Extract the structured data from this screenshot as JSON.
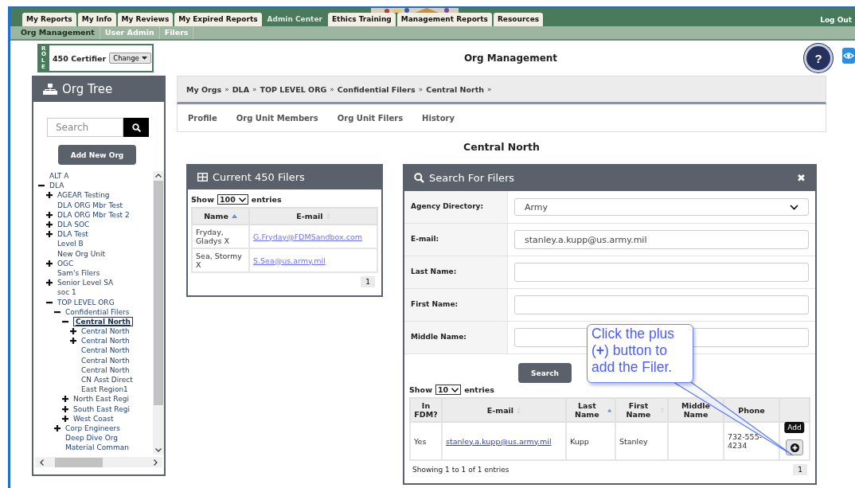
{
  "top_tabs": [
    {
      "label": "My Reports",
      "selected": false
    },
    {
      "label": "My Info",
      "selected": false
    },
    {
      "label": "My Reviews",
      "selected": false
    },
    {
      "label": "My Expired Reports",
      "selected": false
    },
    {
      "label": "Admin Center",
      "selected": true
    },
    {
      "label": "Ethics Training",
      "selected": false
    },
    {
      "label": "Management Reports",
      "selected": false
    },
    {
      "label": "Resources",
      "selected": false
    }
  ],
  "logout": "Log Out",
  "sub_nav": [
    {
      "label": "Org Management",
      "selected": true
    },
    {
      "label": "User Admin",
      "selected": false
    },
    {
      "label": "Filers",
      "selected": false
    }
  ],
  "role": {
    "tag": "ROLE",
    "name": "450 Certifier",
    "button": "Change"
  },
  "page_title": "Org Management",
  "help_button": "?",
  "org_tree": {
    "title": "Org Tree",
    "search_placeholder": "Search",
    "add_button": "Add New Org",
    "items": [
      {
        "label": "ALT A",
        "kind": "leaf",
        "selected": false
      },
      {
        "label": "DLA",
        "kind": "node",
        "expanded": true,
        "selected": false,
        "children": [
          {
            "label": "AGEAR Testing",
            "kind": "node",
            "expanded": false,
            "selected": false
          },
          {
            "label": "DLA ORG Mbr Test",
            "kind": "leaf",
            "selected": false
          },
          {
            "label": "DLA ORG Mbr Test 2",
            "kind": "node",
            "expanded": false,
            "selected": false
          },
          {
            "label": "DLA SOC",
            "kind": "node",
            "expanded": false,
            "selected": false
          },
          {
            "label": "DLA Test",
            "kind": "node",
            "expanded": false,
            "selected": false
          },
          {
            "label": "Level B",
            "kind": "leaf",
            "selected": false
          },
          {
            "label": "New Org Unit",
            "kind": "leaf",
            "selected": false
          },
          {
            "label": "OGC",
            "kind": "node",
            "expanded": false,
            "selected": false
          },
          {
            "label": "Sam's Filers",
            "kind": "leaf",
            "selected": false
          },
          {
            "label": "Senior Level SA",
            "kind": "node",
            "expanded": false,
            "selected": false
          },
          {
            "label": "soc 1",
            "kind": "leaf",
            "selected": false
          },
          {
            "label": "TOP LEVEL ORG",
            "kind": "node",
            "expanded": true,
            "selected": false,
            "children": [
              {
                "label": "Confidential Filers",
                "kind": "node",
                "expanded": true,
                "selected": false,
                "children": [
                  {
                    "label": "Central North",
                    "kind": "node",
                    "expanded": true,
                    "selected": true,
                    "children": [
                      {
                        "label": "Central North",
                        "kind": "node",
                        "expanded": false,
                        "selected": false
                      },
                      {
                        "label": "Central North",
                        "kind": "node",
                        "expanded": false,
                        "selected": false
                      },
                      {
                        "label": "Central North",
                        "kind": "leaf",
                        "selected": false
                      },
                      {
                        "label": "Central North",
                        "kind": "leaf",
                        "selected": false
                      },
                      {
                        "label": "Central North",
                        "kind": "leaf",
                        "selected": false
                      },
                      {
                        "label": "CN Asst Direct",
                        "kind": "leaf",
                        "selected": false
                      },
                      {
                        "label": "East Region1",
                        "kind": "leaf",
                        "selected": false
                      }
                    ]
                  },
                  {
                    "label": "North East Regi",
                    "kind": "node",
                    "expanded": false,
                    "selected": false
                  },
                  {
                    "label": "South East Regi",
                    "kind": "node",
                    "expanded": false,
                    "selected": false
                  },
                  {
                    "label": "West Coast",
                    "kind": "node",
                    "expanded": false,
                    "selected": false
                  }
                ]
              },
              {
                "label": "Corp Engineers",
                "kind": "node",
                "expanded": false,
                "selected": false
              },
              {
                "label": "Deep Dive Org",
                "kind": "leaf",
                "selected": false
              },
              {
                "label": "Material Comman",
                "kind": "leaf",
                "selected": false
              }
            ]
          }
        ]
      }
    ]
  },
  "breadcrumb": [
    "My Orgs",
    "DLA",
    "TOP LEVEL ORG",
    "Confidential Filers",
    "Central North"
  ],
  "breadcrumb_separator": "»",
  "org_tabs": [
    {
      "label": "Profile",
      "selected": false
    },
    {
      "label": "Org Unit Members",
      "selected": false
    },
    {
      "label": "Org Unit Filers",
      "selected": false
    },
    {
      "label": "History",
      "selected": false
    }
  ],
  "org_title": "Central North",
  "current_filers": {
    "title": "Current 450 Filers",
    "show": "Show",
    "page_size": "100",
    "entries": "entries",
    "columns": [
      {
        "label": "Name",
        "sortable": true,
        "sorted": true
      },
      {
        "label": "E-mail",
        "sortable": true,
        "sorted": false
      }
    ],
    "rows": [
      [
        {
          "text": "Fryday, Gladys X",
          "kind": "text"
        },
        {
          "text": "G.Fryday@FDMSandbox.com",
          "kind": "link"
        }
      ],
      [
        {
          "text": "Sea, Stormy X",
          "kind": "text"
        },
        {
          "text": "S.Sea@us.army.mil",
          "kind": "link"
        }
      ]
    ],
    "page": "1"
  },
  "search_filers": {
    "title": "Search For Filers",
    "close": "✖",
    "fields": [
      {
        "label": "Agency Directory:",
        "kind": "select",
        "value": "Army"
      },
      {
        "label": "E-mail:",
        "kind": "text",
        "value": "stanley.a.kupp@us.army.mil"
      },
      {
        "label": "Last Name:",
        "kind": "text"
      },
      {
        "label": "First Name:",
        "kind": "text"
      },
      {
        "label": "Middle Name:",
        "kind": "text"
      }
    ],
    "search_button": "Search",
    "show": "Show",
    "page_size": "10",
    "entries": "entries",
    "columns": [
      {
        "label": "In FDM?",
        "sortable": false,
        "sorted": false
      },
      {
        "label": "E-mail",
        "sortable": true,
        "sorted": false
      },
      {
        "label": "Last Name",
        "sortable": true,
        "sorted": true
      },
      {
        "label": "First Name",
        "sortable": true,
        "sorted": false
      },
      {
        "label": "Middle Name",
        "sortable": false,
        "sorted": false
      },
      {
        "label": "Phone",
        "sortable": false,
        "sorted": false
      }
    ],
    "rows": [
      {
        "cells": [
          {
            "text": "Yes",
            "kind": "text"
          },
          {
            "text": "stanley.a.kupp@us.army.mil",
            "kind": "link"
          },
          {
            "text": "Kupp",
            "kind": "text"
          },
          {
            "text": "Stanley",
            "kind": "text"
          },
          null,
          {
            "text": "732-555-4234",
            "kind": "text"
          }
        ],
        "action_tooltip": "Add"
      }
    ],
    "summary": "Showing 1 to 1 of 1 entries",
    "page": "1"
  },
  "callout": "Click the plus (**+**) button to add the Filer."
}
